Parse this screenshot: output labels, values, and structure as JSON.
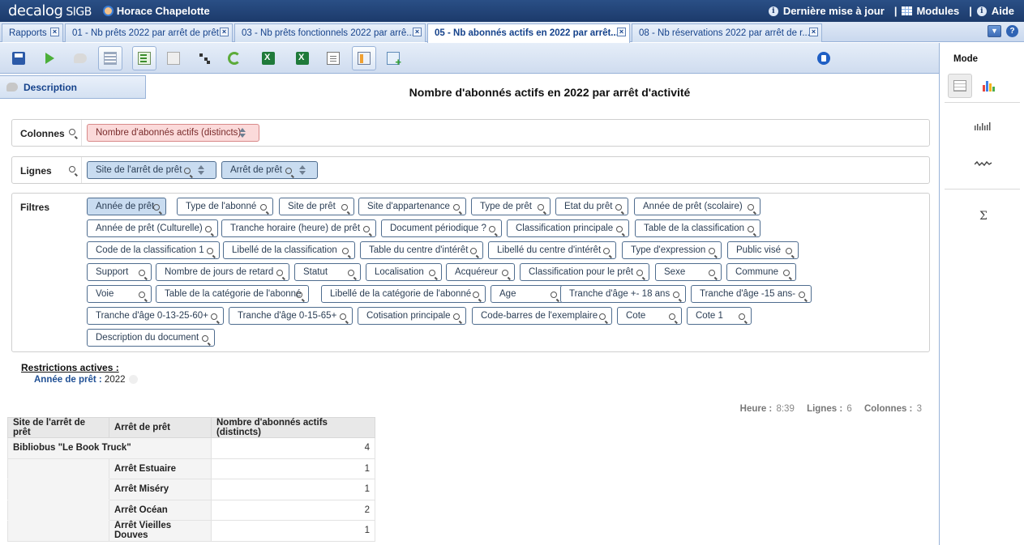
{
  "app": {
    "logo": "decalog",
    "logo_suffix": "SIGB",
    "user": "Horace Chapelotte",
    "links": [
      {
        "label": "Dernière mise à jour",
        "icon": "info-icon"
      },
      {
        "label": "Modules",
        "icon": "grid-icon"
      },
      {
        "label": "Aide",
        "icon": "info-icon"
      }
    ],
    "separator": "|"
  },
  "tabs": [
    {
      "label": "Rapports",
      "active": false
    },
    {
      "label": "01 - Nb prêts 2022 par arrêt de prêt",
      "active": false
    },
    {
      "label": "03 - Nb prêts fonctionnels 2022 par arrê...",
      "active": false
    },
    {
      "label": "05 - Nb abonnés actifs en 2022 par arrêt...",
      "active": true
    },
    {
      "label": "08 - Nb réservations 2022 par arrêt de r...",
      "active": false
    }
  ],
  "toolbar": {
    "buttons": [
      "save-icon",
      "run-icon",
      "comment-icon",
      "list-icon",
      "export-sheet-icon",
      "clear-icon",
      "tree-icon",
      "refresh-icon",
      "excel-icon",
      "excel-icon",
      "document-icon",
      "calculator-icon",
      "add-table-icon",
      "delete-icon"
    ]
  },
  "description_tab": "Description",
  "report_title": "Nombre d'abonnés actifs en 2022 par arrêt d'activité",
  "colonnes": {
    "label": "Colonnes",
    "chips": [
      "Nombre d'abonnés actifs (distincts)"
    ]
  },
  "lignes": {
    "label": "Lignes",
    "chips": [
      "Site de l'arrêt de prêt",
      "Arrêt de prêt"
    ]
  },
  "filtres": {
    "label": "Filtres",
    "rows": [
      [
        "Année de prêt",
        "Type de l'abonné",
        "Site de prêt",
        "Site d'appartenance",
        "Type de prêt",
        "Etat du prêt",
        "Année de prêt (scolaire)"
      ],
      [
        "Année de prêt (Culturelle)",
        "Tranche horaire (heure) de prêt",
        "Document périodique ?",
        "Classification principale",
        "Table de la classification"
      ],
      [
        "Code de la classification 1",
        "Libellé de la classification",
        "Table du centre d'intérêt",
        "Libellé du centre d'intérêt",
        "Type d'expression",
        "Public visé"
      ],
      [
        "Support",
        "Nombre de jours de retard",
        "Statut",
        "Localisation",
        "Acquéreur",
        "Classification pour le prêt",
        "Sexe",
        "Commune"
      ],
      [
        "Voie",
        "Table de la catégorie de l'abonné",
        "Libellé de la catégorie de l'abonné",
        "Age",
        "Tranche d'âge +- 18 ans",
        "Tranche d'âge -15 ans-"
      ],
      [
        "Tranche d'âge 0-13-25-60+",
        "Tranche d'âge 0-15-65+",
        "Cotisation principale",
        "Code-barres de l'exemplaire",
        "Cote",
        "Cote 1"
      ],
      [
        "Description du document"
      ]
    ]
  },
  "restrictions": {
    "title": "Restrictions actives :",
    "key": "Année de prêt :",
    "value": "2022"
  },
  "stats": {
    "heure_label": "Heure :",
    "heure": "8:39",
    "lignes_label": "Lignes :",
    "lignes": "6",
    "colonnes_label": "Colonnes :",
    "colonnes": "3"
  },
  "table": {
    "headers": [
      "Site de l'arrêt de prêt",
      "Arrêt de prêt",
      "Nombre d'abonnés actifs (distincts)"
    ],
    "site": "Bibliobus \"Le Book Truck\"",
    "site_total": "4",
    "rows": [
      {
        "arret": "Arrêt Estuaire",
        "value": "1"
      },
      {
        "arret": "Arrêt Miséry",
        "value": "1"
      },
      {
        "arret": "Arrêt Océan",
        "value": "2"
      },
      {
        "arret": "Arrêt Vieilles Douves",
        "value": "1"
      }
    ]
  },
  "right_panel": {
    "title": "Mode",
    "buttons": [
      "table-view-icon",
      "chart-view-icon",
      "bar-sparkline-icon",
      "line-sparkline-icon",
      "sigma-icon"
    ]
  }
}
